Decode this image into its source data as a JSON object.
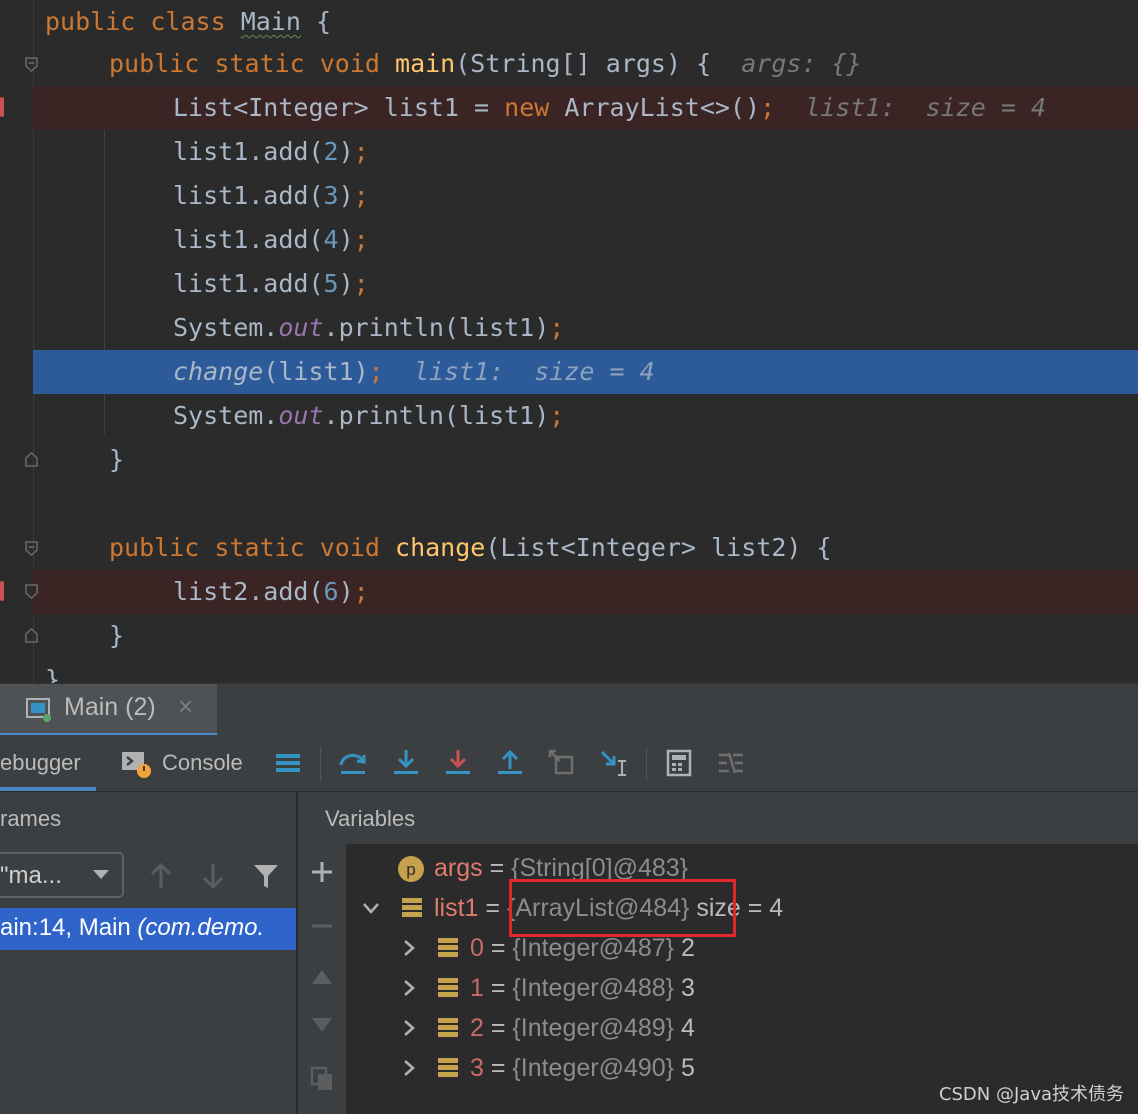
{
  "code": {
    "l1": {
      "kw1": "public",
      "kw2": "class",
      "name": "Main",
      "brace": "{"
    },
    "l2": {
      "kw1": "public",
      "kw2": "static",
      "kw3": "void",
      "fn": "main",
      "params": "(String[] args) {",
      "hint": "args: {}"
    },
    "l3": {
      "type": "List<Integer> list1 = ",
      "kw": "new",
      "rest": "ArrayList<>()",
      "semi": ";",
      "hint": "list1:  size = 4"
    },
    "l4": {
      "pre": "list1.add(",
      "num": "2",
      "post": ")",
      "semi": ";"
    },
    "l5": {
      "pre": "list1.add(",
      "num": "3",
      "post": ")",
      "semi": ";"
    },
    "l6": {
      "pre": "list1.add(",
      "num": "4",
      "post": ")",
      "semi": ";"
    },
    "l7": {
      "pre": "list1.add(",
      "num": "5",
      "post": ")",
      "semi": ";"
    },
    "l8": {
      "pre": "System.",
      "field": "out",
      "post": ".println(list1)",
      "semi": ";"
    },
    "l9": {
      "fn": "change",
      "post": "(list1)",
      "semi": ";",
      "hint": "list1:  size = 4"
    },
    "l10": {
      "pre": "System.",
      "field": "out",
      "post": ".println(list1)",
      "semi": ";"
    },
    "l11": {
      "brace": "}"
    },
    "l13": {
      "kw1": "public",
      "kw2": "static",
      "kw3": "void",
      "fn": "change",
      "params": "(List<Integer> list2) {"
    },
    "l14": {
      "pre": "list2.add(",
      "num": "6",
      "post": ")",
      "semi": ";"
    },
    "l15": {
      "brace": "}"
    },
    "l16": {
      "brace": "}"
    }
  },
  "tab": {
    "title": "Main (2)",
    "close": "×"
  },
  "toolbar": {
    "debugger": "ebugger",
    "console": "Console"
  },
  "frames": {
    "header": "rames",
    "thread": "\"ma...",
    "frame": "ain:14, Main",
    "frame_pkg": "(com.demo."
  },
  "variables": {
    "header": "Variables",
    "items": [
      {
        "name": "args",
        "eq": " = ",
        "ref": "{String[0]@483}",
        "val": ""
      },
      {
        "name": "list1",
        "eq": " = ",
        "ref": "{ArrayList@484}",
        "val": " size = 4"
      },
      {
        "name": "0",
        "eq": " = ",
        "ref": "{Integer@487}",
        "val": " 2"
      },
      {
        "name": "1",
        "eq": " = ",
        "ref": "{Integer@488}",
        "val": " 3"
      },
      {
        "name": "2",
        "eq": " = ",
        "ref": "{Integer@489}",
        "val": " 4"
      },
      {
        "name": "3",
        "eq": " = ",
        "ref": "{Integer@490}",
        "val": " 5"
      }
    ]
  },
  "watermark": "CSDN @Java技术债务",
  "colors": {
    "keyword": "#cc7832",
    "function": "#ffc66d",
    "number": "#6897bb",
    "field": "#9876aa",
    "current_line": "#2d5b9a",
    "breakpoint_line": "#3b2424",
    "highlight_box": "#e0282a"
  }
}
